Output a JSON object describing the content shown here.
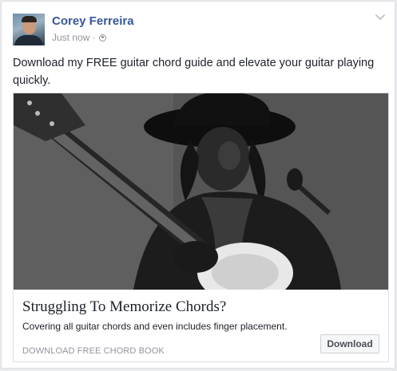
{
  "post": {
    "author_name": "Corey Ferreira",
    "timestamp": "Just now",
    "separator": "·",
    "audience_icon": "globe-icon",
    "options_icon": "chevron-down-icon",
    "text": "Download my FREE guitar chord guide and elevate your guitar playing quickly."
  },
  "link_card": {
    "image_icon": "guitarist-photo",
    "title": "Struggling To Memorize Chords?",
    "description": "Covering all guitar chords and even includes finger placement.",
    "domain_caption": "DOWNLOAD FREE CHORD BOOK",
    "cta_label": "Download"
  },
  "colors": {
    "author_link": "#365899",
    "meta_text": "#90949c",
    "body_text": "#1d2129",
    "page_background": "#e9ebee"
  }
}
